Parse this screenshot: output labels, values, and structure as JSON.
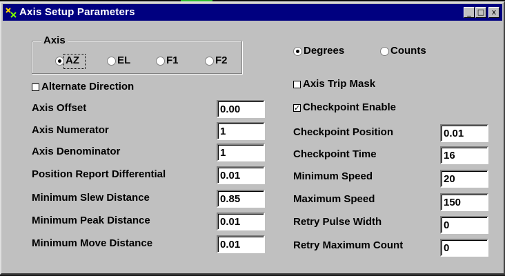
{
  "window": {
    "title": "Axis Setup Parameters",
    "controls": {
      "minimize": "_",
      "maximize": "□",
      "close": "x"
    }
  },
  "axis_group": {
    "label": "Axis",
    "options": [
      "AZ",
      "EL",
      "F1",
      "F2"
    ],
    "selected": "AZ"
  },
  "units": {
    "options": [
      "Degrees",
      "Counts"
    ],
    "selected": "Degrees"
  },
  "checkboxes": {
    "alternate_direction": {
      "label": "Alternate Direction",
      "checked": false
    },
    "axis_trip_mask": {
      "label": "Axis Trip Mask",
      "checked": false
    },
    "checkpoint_enable": {
      "label": "Checkpoint Enable",
      "checked": true,
      "mark": "✓"
    }
  },
  "left_fields": [
    {
      "label": "Axis Offset",
      "value": "0.00"
    },
    {
      "label": "Axis Numerator",
      "value": "1"
    },
    {
      "label": "Axis Denominator",
      "value": "1"
    },
    {
      "label": "Position Report Differential",
      "value": "0.01"
    },
    {
      "label": "Minimum Slew Distance",
      "value": "0.85"
    },
    {
      "label": "Minimum Peak Distance",
      "value": "0.01"
    },
    {
      "label": "Minimum Move Distance",
      "value": "0.01"
    }
  ],
  "right_fields": [
    {
      "label": "Checkpoint Position",
      "value": "0.01"
    },
    {
      "label": "Checkpoint Time",
      "value": "16"
    },
    {
      "label": "Minimum Speed",
      "value": "20"
    },
    {
      "label": "Maximum Speed",
      "value": "150"
    },
    {
      "label": "Retry Pulse Width",
      "value": "0"
    },
    {
      "label": "Retry Maximum Count",
      "value": "0"
    }
  ]
}
